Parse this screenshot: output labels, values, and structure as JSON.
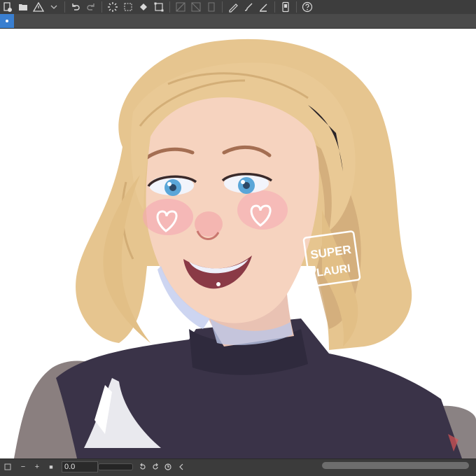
{
  "toolbar": {
    "buttons": [
      {
        "icon": "new-canvas-icon"
      },
      {
        "icon": "open-folder-icon"
      },
      {
        "icon": "warning-icon"
      },
      {
        "icon": "undo-icon"
      },
      {
        "icon": "redo-icon"
      },
      {
        "icon": "spinner-icon"
      },
      {
        "icon": "selection-icon"
      },
      {
        "icon": "fill-icon"
      },
      {
        "icon": "transform-icon"
      },
      {
        "icon": "grid-icon"
      },
      {
        "icon": "ruler-icon"
      },
      {
        "icon": "layer-icon"
      },
      {
        "icon": "pen-check-icon"
      },
      {
        "icon": "brush-icon"
      },
      {
        "icon": "pencil-icon"
      },
      {
        "icon": "device-icon"
      },
      {
        "icon": "help-icon"
      }
    ]
  },
  "canvas": {
    "artwork": "portrait",
    "signature": "SUPER LAURI"
  },
  "statusbar": {
    "zoom_value": "0.0",
    "minus_label": "−",
    "plus_label": "+",
    "stop_label": "■"
  },
  "colors": {
    "accent": "#3a7fd0",
    "hair": "#e4c48c",
    "skin": "#f6d3bf",
    "sweater": "#3a3348",
    "eyes": "#5aa6d8"
  }
}
